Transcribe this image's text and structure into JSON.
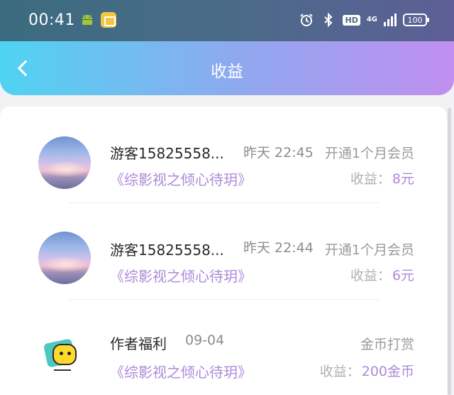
{
  "status_bar": {
    "time": "00:41",
    "network": "4G",
    "battery": "100",
    "hd": "HD"
  },
  "header": {
    "title": "收益"
  },
  "records": [
    {
      "name": "游客15825558...",
      "time": "昨天 22:45",
      "type": "开通1个月会员",
      "book": "《综影视之倾心待玥》",
      "earn_label": "收益：",
      "earn_amount": "8元",
      "avatar": "sky"
    },
    {
      "name": "游客15825558...",
      "time": "昨天 22:44",
      "type": "开通1个月会员",
      "book": "《综影视之倾心待玥》",
      "earn_label": "收益：",
      "earn_amount": "6元",
      "avatar": "sky"
    },
    {
      "name": "作者福利",
      "time": "09-04",
      "type": "金币打赏",
      "book": "《综影视之倾心待玥》",
      "earn_label": "收益：",
      "earn_amount": "200金币",
      "avatar": "cartoon"
    }
  ],
  "colors": {
    "accent_purple": "#ad8ad8",
    "header_start": "#4fd3f2",
    "header_end": "#c08ff0"
  }
}
